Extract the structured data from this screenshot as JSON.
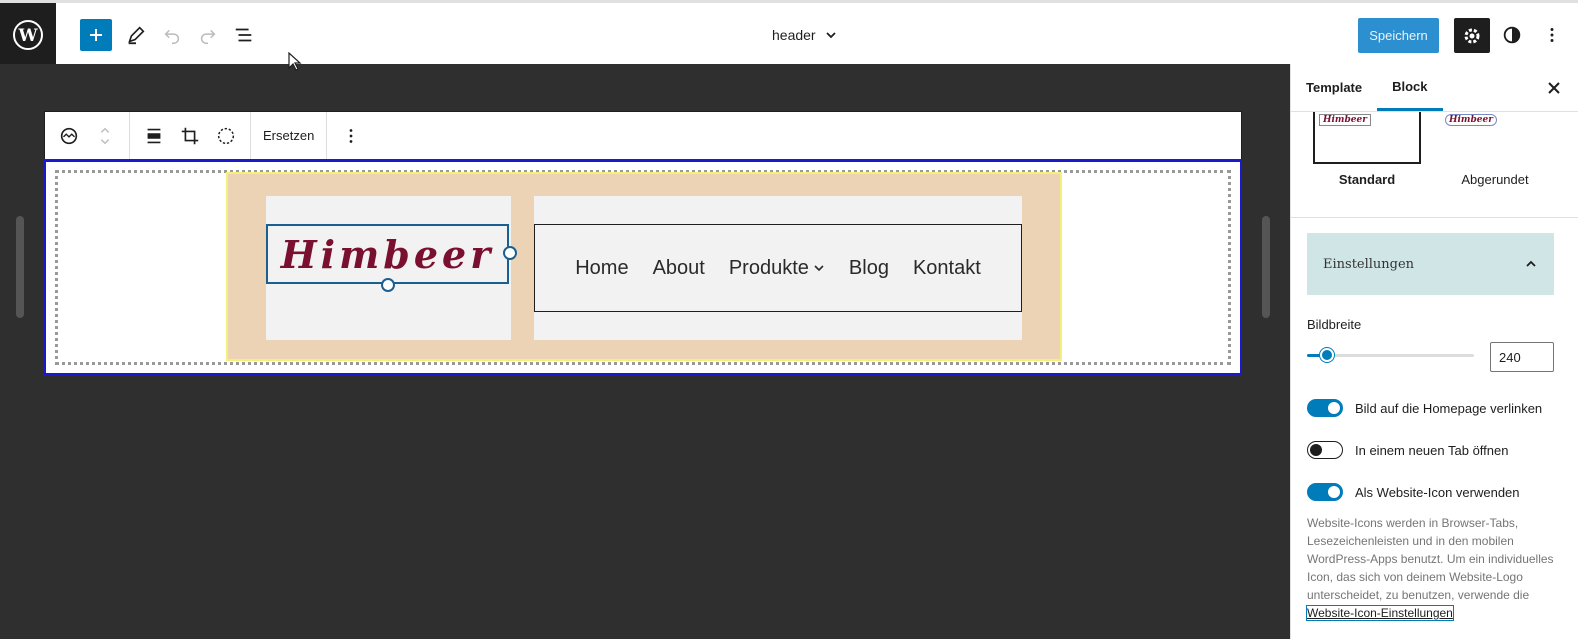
{
  "topbar": {
    "document_title": "header",
    "save_label": "Speichern"
  },
  "block_toolbar": {
    "replace_label": "Ersetzen"
  },
  "canvas": {
    "logo_text": "Himbeer",
    "nav_items": [
      "Home",
      "About",
      "Produkte",
      "Blog",
      "Kontakt"
    ]
  },
  "sidebar": {
    "tabs": [
      "Template",
      "Block"
    ],
    "active_tab": "Block",
    "styles": [
      {
        "label": "Standard",
        "active": true
      },
      {
        "label": "Abgerundet",
        "active": false
      }
    ],
    "settings_panel_title": "Einstellungen",
    "image_width_label": "Bildbreite",
    "image_width_value": "240",
    "image_width_slider_fraction": 0.12,
    "toggles": [
      {
        "label": "Bild auf die Homepage verlinken",
        "on": true
      },
      {
        "label": "In einem neuen Tab öffnen",
        "on": false
      },
      {
        "label": "Als Website-Icon verwenden",
        "on": true
      }
    ],
    "help_text": "Website-Icons werden in Browser-Tabs, Lesezeichenleisten und in den mobilen WordPress-Apps benutzt. Um ein individuelles Icon, das sich von deinem Website-Logo unterscheidet, zu benutzen, verwende die",
    "help_link": "Website-Icon-Einstellungen"
  },
  "colors": {
    "accent": "#007cba",
    "logo": "#7a1030",
    "group_bg": "#edd3b6",
    "canvas_bg": "#2f2f2f"
  }
}
